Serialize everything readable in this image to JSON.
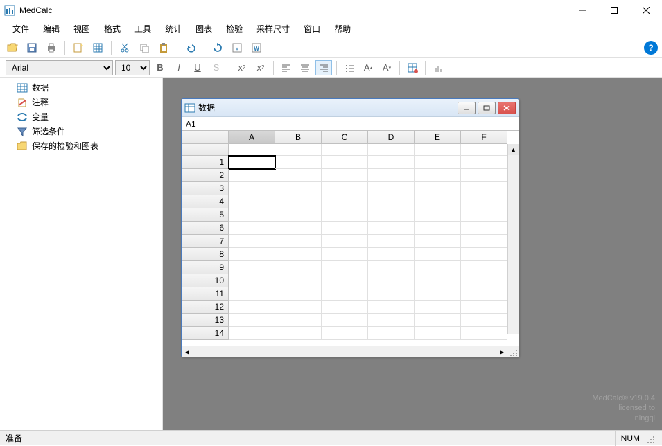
{
  "app": {
    "title": "MedCalc"
  },
  "menu": {
    "items": [
      "文件",
      "编辑",
      "视图",
      "格式",
      "工具",
      "统计",
      "图表",
      "检验",
      "采样尺寸",
      "窗口",
      "帮助"
    ]
  },
  "font": {
    "family": "Arial",
    "size": "10"
  },
  "sidebar": {
    "items": [
      {
        "label": "数据",
        "icon": "table-icon"
      },
      {
        "label": "注释",
        "icon": "notes-icon"
      },
      {
        "label": "变量",
        "icon": "variables-icon"
      },
      {
        "label": "筛选条件",
        "icon": "filter-icon"
      },
      {
        "label": "保存的检验和图表",
        "icon": "folder-icon"
      }
    ]
  },
  "data_window": {
    "title": "数据",
    "cell_ref": "A1",
    "columns": [
      "A",
      "B",
      "C",
      "D",
      "E",
      "F"
    ],
    "rows": [
      1,
      2,
      3,
      4,
      5,
      6,
      7,
      8,
      9,
      10,
      11,
      12,
      13,
      14
    ]
  },
  "watermark": {
    "line1": "MedCalc® v19.0.4",
    "line2": "licensed to",
    "line3": "ningqi"
  },
  "status": {
    "left": "准备",
    "right": "NUM"
  }
}
